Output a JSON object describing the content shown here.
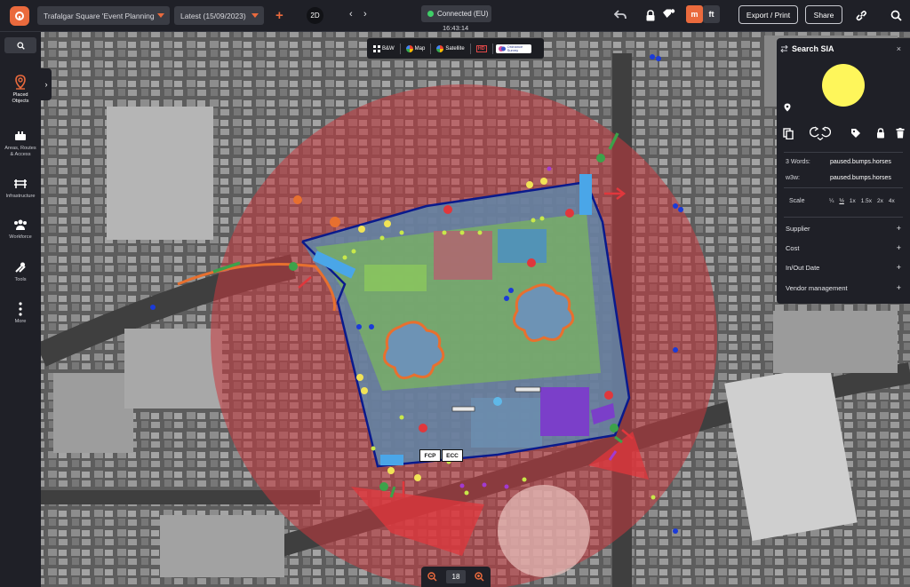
{
  "topbar": {
    "project": "Trafalgar Square 'Event Planning",
    "version": "Latest (15/09/2023)",
    "add": "+",
    "view_mode": "2D",
    "back": "‹",
    "forward": "›",
    "connection": "Connected (EU)",
    "time": "16:43:14",
    "unit_m": "m",
    "unit_ft": "ft",
    "export": "Export / Print",
    "share": "Share"
  },
  "sidebar": {
    "items": [
      {
        "label1": "Placed",
        "label2": "Objects"
      },
      {
        "label1": "Areas, Routes",
        "label2": "& Access"
      },
      {
        "label1": "Infrastructure",
        "label2": ""
      },
      {
        "label1": "Workforce",
        "label2": ""
      },
      {
        "label1": "Tools",
        "label2": ""
      },
      {
        "label1": "More",
        "label2": ""
      }
    ],
    "expander": "›"
  },
  "layerbar": {
    "bw": "B&W",
    "map": "Map",
    "satellite": "Satellite",
    "hd": "HD",
    "ordnance": "Ordnance Survey"
  },
  "map_labels": {
    "fcp": "FCP",
    "ecc": "ECC"
  },
  "zoom": {
    "level": "18",
    "minus": "−",
    "plus": "+"
  },
  "panel": {
    "title": "Search SIA",
    "close": "×",
    "three_words_label": "3 Words:",
    "three_words": "paused.bumps.horses",
    "w3w_label": "w3w:",
    "w3w": "paused.bumps.horses",
    "scale_label": "Scale",
    "scale_options": [
      "¼",
      "½",
      "1x",
      "1.5x",
      "2x",
      "4x"
    ],
    "sections": [
      "Supplier",
      "Cost",
      "In/Out Date",
      "Vendor management"
    ],
    "plus": "+"
  },
  "colors": {
    "accent": "#ea6a3d",
    "panel_bg": "#1f2027",
    "exclusion_zone": "#c9393e",
    "boundary": "#0a1a8c",
    "connected": "#3fcf67",
    "marker": "#fef65b"
  }
}
